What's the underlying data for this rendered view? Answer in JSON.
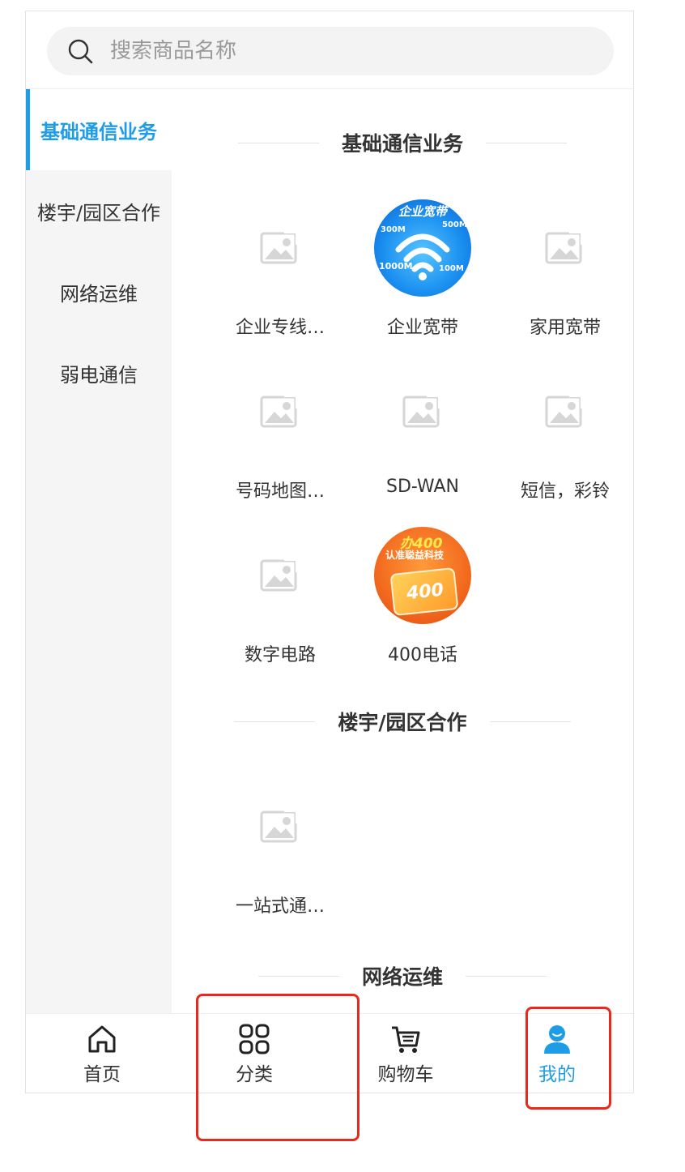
{
  "search": {
    "placeholder": "搜索商品名称"
  },
  "sidebar": {
    "items": [
      {
        "label": "基础通信业务",
        "active": true
      },
      {
        "label": "楼宇/园区合作",
        "active": false
      },
      {
        "label": "网络运维",
        "active": false
      },
      {
        "label": "弱电通信",
        "active": false
      }
    ]
  },
  "sections": [
    {
      "title": "基础通信业务",
      "items": [
        {
          "label": "企业专线…",
          "image": "placeholder-image-icon"
        },
        {
          "label": "企业宽带",
          "image": "broadband-product-image"
        },
        {
          "label": "家用宽带",
          "image": "placeholder-image-icon"
        },
        {
          "label": "号码地图…",
          "image": "placeholder-image-icon"
        },
        {
          "label": "SD-WAN",
          "image": "placeholder-image-icon"
        },
        {
          "label": "短信，彩铃",
          "image": "placeholder-image-icon"
        },
        {
          "label": "数字电路",
          "image": "placeholder-image-icon"
        },
        {
          "label": "400电话",
          "image": "400-phone-product-image"
        }
      ]
    },
    {
      "title": "楼宇/园区合作",
      "items": [
        {
          "label": "一站式通…",
          "image": "placeholder-image-icon"
        }
      ]
    },
    {
      "title": "网络运维",
      "items": []
    }
  ],
  "images": {
    "broadband": {
      "banner": "企业宽带",
      "left_top": "300M",
      "right_top": "500M",
      "left_bottom": "1000M",
      "right_bottom": "100M"
    },
    "phone400": {
      "line1": "办400",
      "line2": "认准聪益科技",
      "card": "400"
    }
  },
  "tabbar": {
    "items": [
      {
        "label": "首页",
        "icon": "home-icon",
        "active": false
      },
      {
        "label": "分类",
        "icon": "grid-icon",
        "active": false
      },
      {
        "label": "购物车",
        "icon": "cart-icon",
        "active": false
      },
      {
        "label": "我的",
        "icon": "user-icon",
        "active": true
      }
    ]
  },
  "colors": {
    "accent": "#1e9de6",
    "highlight": "#e8291c"
  }
}
